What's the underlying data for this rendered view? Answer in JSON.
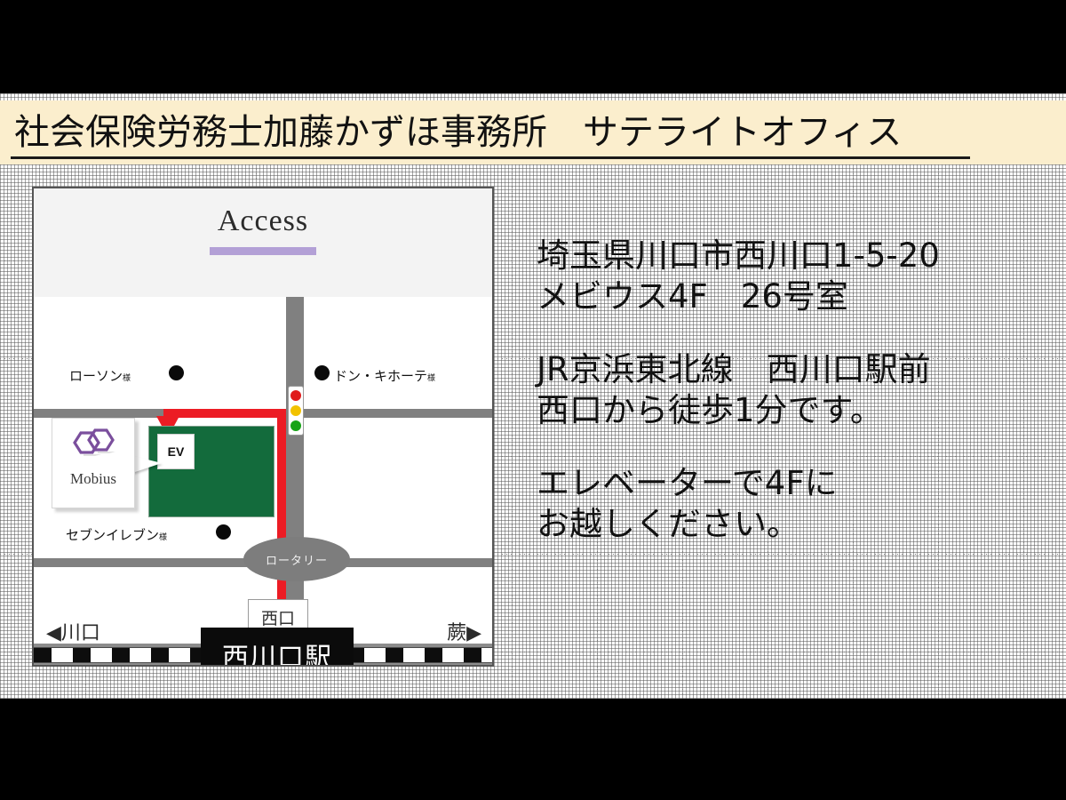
{
  "slide": {
    "title": "社会保険労務士加藤かずほ事務所　サテライトオフィス",
    "background_color": "#ffffff",
    "banner_color": "#fbeecd",
    "letterbox_color": "#000000"
  },
  "map": {
    "heading": "Access",
    "heading_rule_color": "#b3a0d6",
    "shops": [
      {
        "name": "ローソン",
        "suffix": "様",
        "marker": "black-dot"
      },
      {
        "name": "ドン・キホーテ",
        "suffix": "様",
        "marker": "black-dot"
      },
      {
        "name": "セブンイレブン",
        "suffix": "様",
        "marker": "black-dot"
      }
    ],
    "building": {
      "color": "#136b3c",
      "entrance_label": "EV",
      "callout_name": "Mobius",
      "logo_color": "#7B4F9D"
    },
    "route_color": "#ec1c24",
    "traffic_light": {
      "red": "#e01b1b",
      "yellow": "#f2c200",
      "green": "#17a317"
    },
    "rotary_label": "ロータリー",
    "west_exit_label": "西口",
    "station_label": "西川口駅",
    "direction_left": "◀川口",
    "direction_right": "蕨▶",
    "road_color": "#808080"
  },
  "info": {
    "address": {
      "line1": "埼玉県川口市西川口1-5-20",
      "line2": "メビウス4F　26号室"
    },
    "access": {
      "line1": "JR京浜東北線　西川口駅前",
      "line2": "西口から徒歩1分です。"
    },
    "elevator": {
      "line1": "エレベーターで4Fに",
      "line2": "お越しください。"
    }
  }
}
